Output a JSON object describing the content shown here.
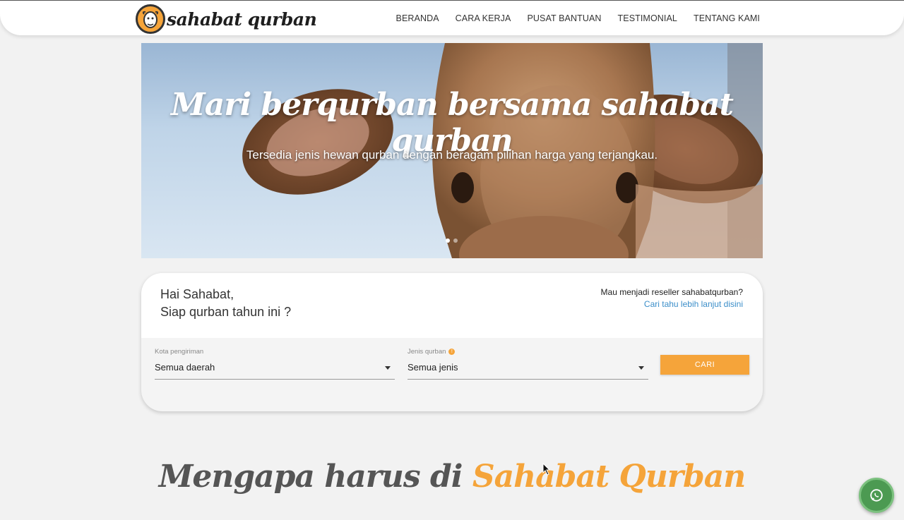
{
  "brand": {
    "name": "sahabat qurban",
    "logo_icon": "goat-face-logo-icon"
  },
  "nav": {
    "items": [
      {
        "label": "BERANDA"
      },
      {
        "label": "CARA KERJA"
      },
      {
        "label": "PUSAT BANTUAN"
      },
      {
        "label": "TESTIMONIAL"
      },
      {
        "label": "TENTANG KAMI"
      }
    ]
  },
  "hero": {
    "title": "Mari berqurban bersama sahabat qurban",
    "subtitle": "Tersedia jenis hewan qurban dengan beragam pilihan harga yang terjangkau.",
    "slide_count": 2,
    "active_slide": 1,
    "image_subject": "cow"
  },
  "search": {
    "greeting_line1": "Hai Sahabat,",
    "greeting_line2": "Siap qurban tahun ini ?",
    "reseller_question": "Mau menjadi reseller sahabatqurban?",
    "reseller_link": "Cari tahu lebih lanjut disini",
    "city_label": "Kota pengiriman",
    "city_value": "Semua daerah",
    "type_label": "Jenis qurban",
    "type_info_icon": "info-icon",
    "type_value": "Semua jenis",
    "button_label": "CARI"
  },
  "section": {
    "heading_part1": "Mengapa harus di",
    "heading_part2": "Sahabat Qurban"
  },
  "floating": {
    "icon": "whatsapp-icon"
  },
  "colors": {
    "accent": "#f5a43a",
    "link": "#3b8ec9",
    "whatsapp": "#4c9a52",
    "background": "#f2f2f2"
  }
}
